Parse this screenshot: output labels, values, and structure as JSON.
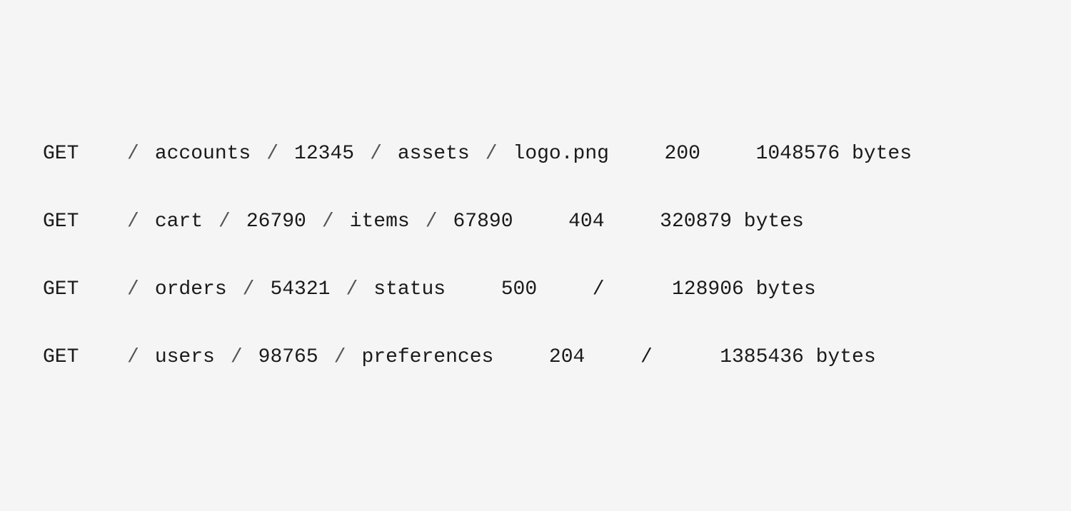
{
  "logs": [
    {
      "method": "GET",
      "parts": [
        "/",
        "accounts",
        "/",
        "12345",
        "/",
        "assets",
        "/",
        "logo.png"
      ],
      "status": "200",
      "size": "1048576 bytes"
    },
    {
      "method": "GET",
      "parts": [
        "/",
        "cart",
        "/",
        "26790",
        "/",
        "items",
        "/",
        "67890"
      ],
      "status": "404",
      "size": "320879 bytes"
    },
    {
      "method": "GET",
      "parts": [
        "/",
        "orders",
        "/",
        "54321",
        "/",
        "status"
      ],
      "status": "500",
      "size": "/",
      "extra": "128906 bytes"
    },
    {
      "method": "GET",
      "parts": [
        "/",
        "users",
        "/",
        "98765",
        "/",
        "preferences"
      ],
      "status": "204",
      "size": "/",
      "extra": "1385436 bytes"
    }
  ]
}
